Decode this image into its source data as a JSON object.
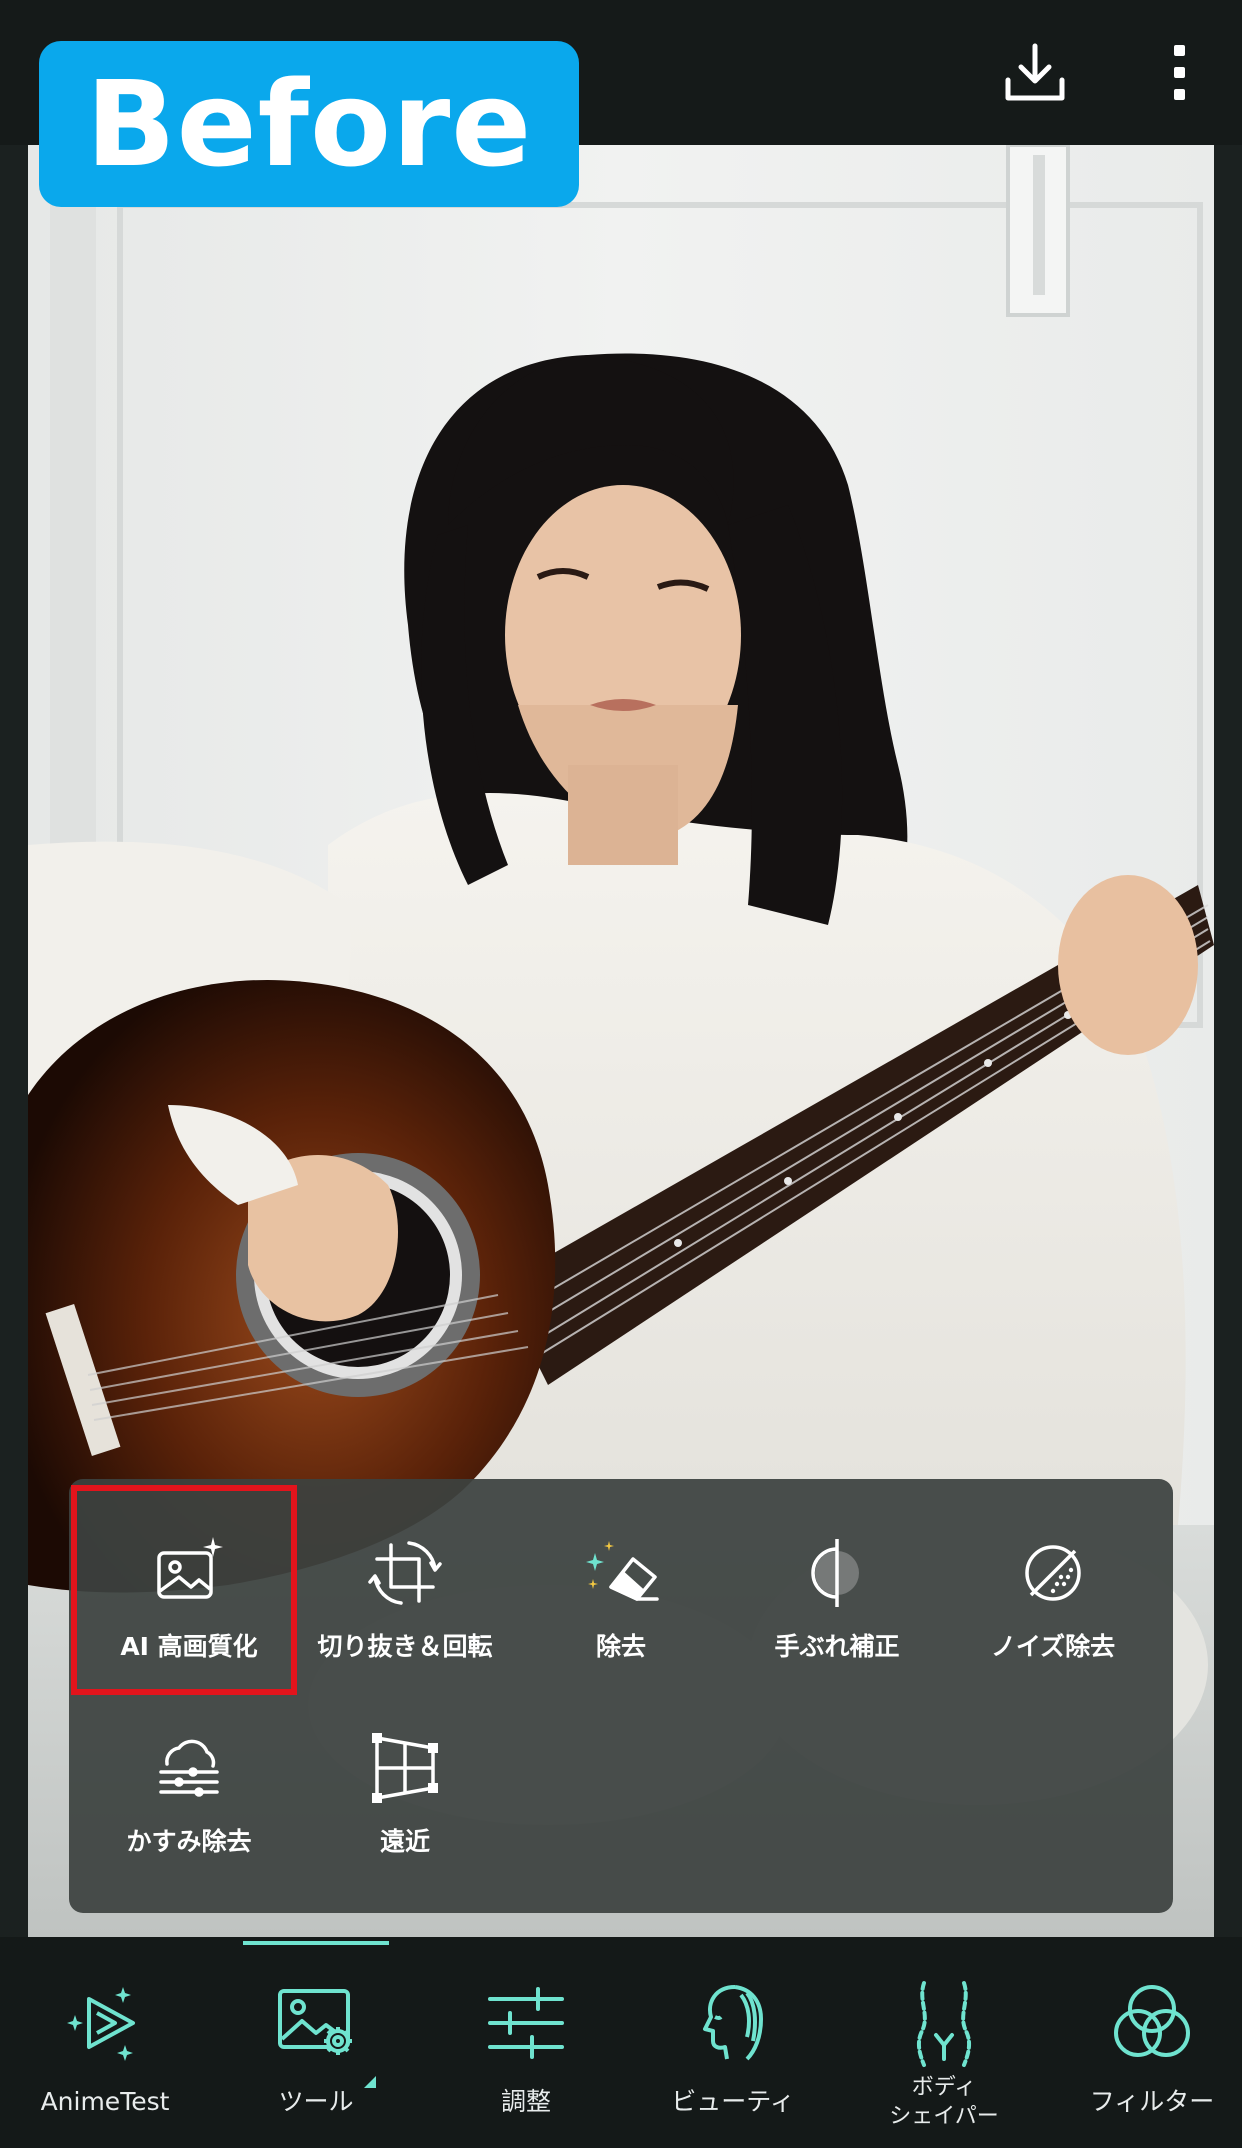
{
  "badge": {
    "label": "Before"
  },
  "top_actions": [
    {
      "icon": "download-icon"
    },
    {
      "icon": "more-vertical-icon"
    }
  ],
  "tools": [
    {
      "label": "AI 高画質化",
      "icon": "ai-enhance-icon",
      "selected": true
    },
    {
      "label": "切り抜き＆回転",
      "icon": "crop-rotate-icon"
    },
    {
      "label": "除去",
      "icon": "eraser-icon"
    },
    {
      "label": "手ぶれ補正",
      "icon": "stabilize-icon"
    },
    {
      "label": "ノイズ除去",
      "icon": "denoise-icon"
    },
    {
      "label": "かすみ除去",
      "icon": "dehaze-icon"
    },
    {
      "label": "遠近",
      "icon": "perspective-icon"
    }
  ],
  "nav": [
    {
      "label": "AnimeTest",
      "icon": "anime-play-icon"
    },
    {
      "label": "ツール",
      "icon": "image-tools-icon",
      "active": true
    },
    {
      "label": "調整",
      "icon": "sliders-icon"
    },
    {
      "label": "ビューティ",
      "icon": "face-profile-icon"
    },
    {
      "label_line1": "ボディ",
      "label_line2": "シェイパー",
      "icon": "body-shaper-icon"
    },
    {
      "label": "フィルター",
      "icon": "filter-circles-icon"
    }
  ],
  "colors": {
    "accent": "#6fe3cf",
    "badge": "#0aa8ec",
    "highlight": "#e2141c"
  }
}
